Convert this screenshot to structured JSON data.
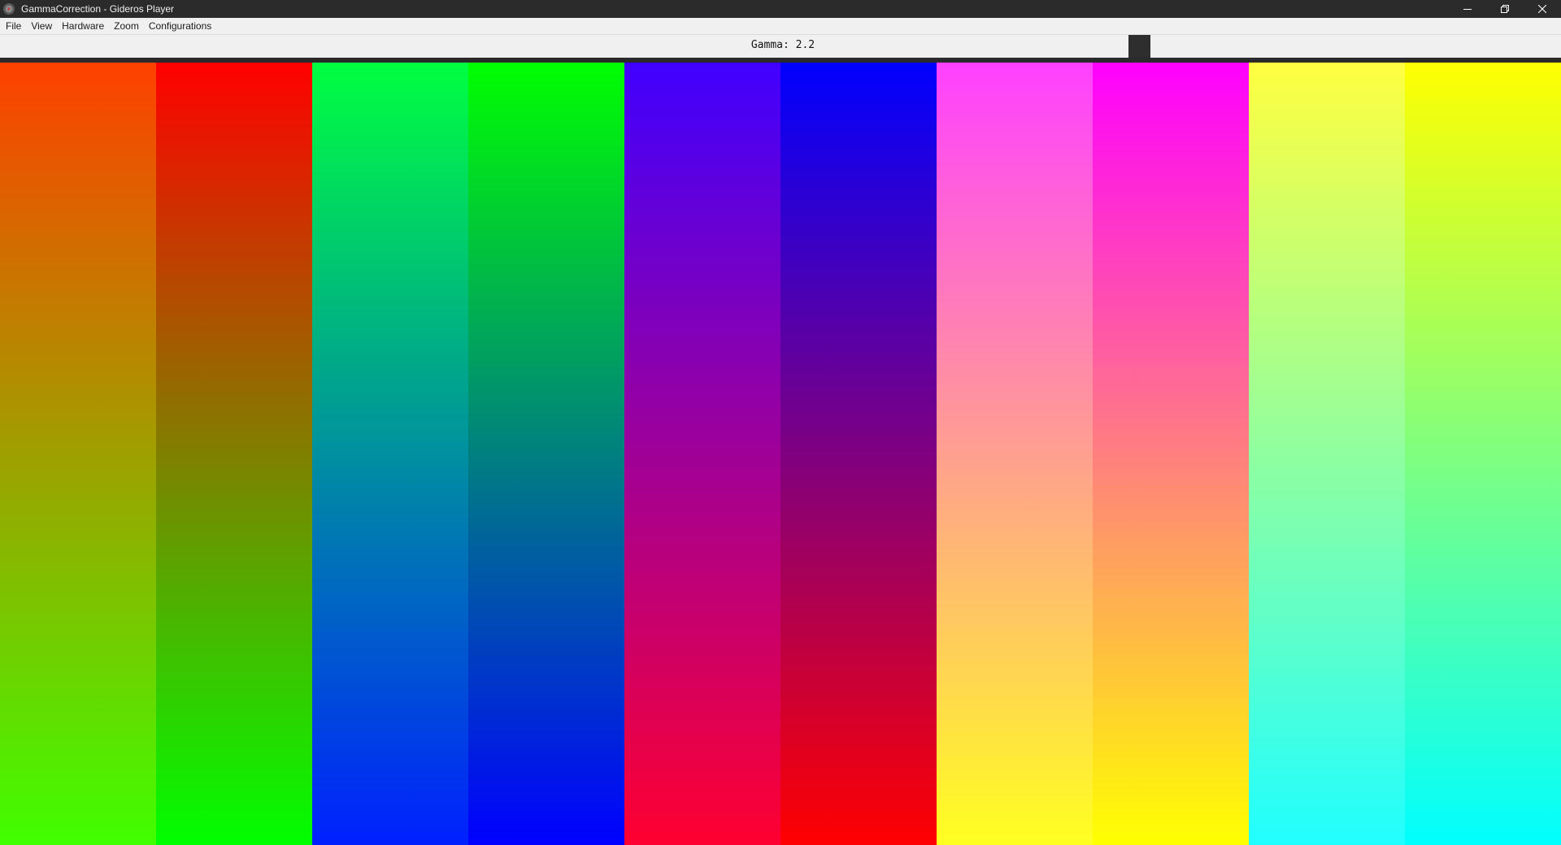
{
  "window": {
    "title": "GammaCorrection - Gideros Player",
    "app_icon": "gideros-player-icon",
    "controls": {
      "minimize_icon": "minimize-icon",
      "restore_icon": "restore-icon",
      "close_icon": "close-icon"
    }
  },
  "menu": {
    "items": [
      {
        "label": "File"
      },
      {
        "label": "View"
      },
      {
        "label": "Hardware"
      },
      {
        "label": "Zoom"
      },
      {
        "label": "Configurations"
      }
    ]
  },
  "gamma": {
    "label": "Gamma: 2.2"
  },
  "colors": {
    "titlebar": "#2b2b2b",
    "menubar": "#f0f0f0",
    "slider_handle": "#2e2e2e"
  },
  "bars": [
    {
      "name": "red-yellow-green-corrected",
      "top": "#ff4000",
      "bottom": "#40ff00"
    },
    {
      "name": "red-green-linear",
      "top": "#ff0000",
      "bottom": "#00ff00"
    },
    {
      "name": "green-blue-corrected",
      "top": "#00ff40",
      "bottom": "#0020ff"
    },
    {
      "name": "green-blue-linear",
      "top": "#00ff00",
      "bottom": "#0000ff"
    },
    {
      "name": "blue-red-corrected",
      "top": "#4000ff",
      "bottom": "#ff0030"
    },
    {
      "name": "blue-red-linear",
      "top": "#0000ff",
      "bottom": "#ff0000"
    },
    {
      "name": "magenta-yellow-corrected",
      "top": "#ff40ff",
      "bottom": "#ffff20"
    },
    {
      "name": "magenta-yellow-linear",
      "top": "#ff00ff",
      "bottom": "#ffff00"
    },
    {
      "name": "yellow-cyan-corrected",
      "top": "#ffff40",
      "bottom": "#20ffff"
    },
    {
      "name": "yellow-cyan-linear",
      "top": "#ffff00",
      "bottom": "#00ffff"
    }
  ]
}
